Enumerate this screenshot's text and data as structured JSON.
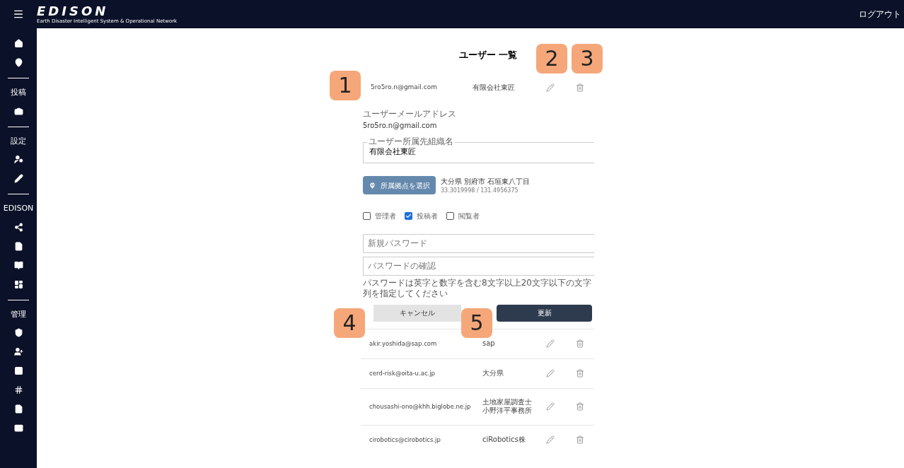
{
  "header": {
    "logo": "EDISON",
    "logo_subtitle": "Earth Disaster Intelligent System & Operational Network",
    "logout": "ログアウト"
  },
  "sidebar": {
    "sections": [
      {
        "heading": "投稿"
      },
      {
        "heading": "設定"
      },
      {
        "heading": "EDISON"
      },
      {
        "heading": "管理"
      }
    ]
  },
  "page": {
    "title": "ユーザー 一覧"
  },
  "editing_user": {
    "email": "5ro5ro.n@gmail.com",
    "organization": "有限会社東匠"
  },
  "form": {
    "email_label": "ユーザーメールアドレス",
    "email": "5ro5ro.n@gmail.com",
    "org_label": "ユーザー所属先組織名",
    "org_value": "有限会社東匠",
    "location_button": "所属拠点を選択",
    "address": "大分県 別府市 石垣東八丁目",
    "coordinates": "33.3019998 / 131.4956375",
    "roles": [
      {
        "label": "管理者",
        "checked": false
      },
      {
        "label": "投稿者",
        "checked": true
      },
      {
        "label": "閲覧者",
        "checked": false
      }
    ],
    "new_password": {
      "placeholder": "新規パスワード"
    },
    "confirm_password": {
      "placeholder": "パスワードの確認"
    },
    "hint": "パスワードは英字と数字を含む8文字以上20文字以下の文字列を指定してください",
    "cancel": "キャンセル",
    "update": "更新"
  },
  "users": [
    {
      "email": "akir.yoshida@sap.com",
      "organization": "sap"
    },
    {
      "email": "cerd-risk@oita-u.ac.jp",
      "organization": "大分県"
    },
    {
      "email": "chousashi-ono@khh.biglobe.ne.jp",
      "organization": "土地家屋調査士小野洋平事務所"
    },
    {
      "email": "cirobotics@cirobotics.jp",
      "organization": "ciRobotics株"
    }
  ],
  "callouts": [
    "1",
    "2",
    "3",
    "4",
    "5"
  ]
}
